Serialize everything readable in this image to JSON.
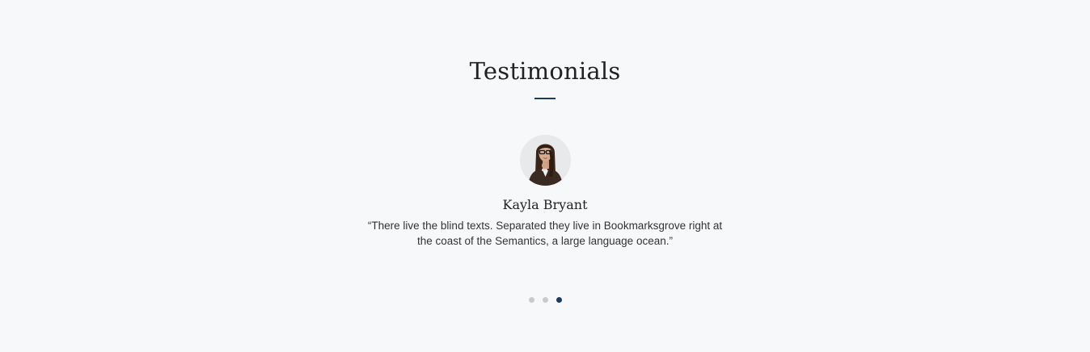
{
  "section": {
    "title": "Testimonials"
  },
  "testimonial": {
    "name": "Kayla Bryant",
    "quote": "“There live the blind texts. Separated they live in Bookmarksgrove right at the coast of the Semantics, a large language ocean.”",
    "avatar": "woman-with-glasses-portrait"
  },
  "carousel": {
    "dot_count": 3,
    "active_index": 2
  },
  "colors": {
    "background": "#f7f8fa",
    "accent": "#1e3a5f",
    "inactive_dot": "#c8cacd"
  }
}
